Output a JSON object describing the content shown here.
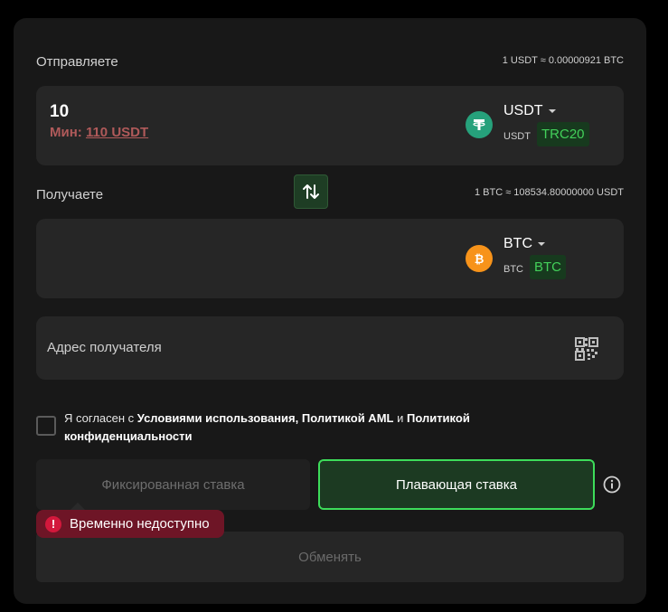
{
  "send": {
    "label": "Отправляете",
    "rate": "1 USDT ≈ 0.00000921 BTC",
    "amount": "10",
    "min_prefix": "Мин:",
    "min_value": "110 USDT",
    "currency": "USDT",
    "currency_small": "USDT",
    "network": "TRC20",
    "coin_icon": "tether-icon",
    "coin_color": "#26a17b"
  },
  "receive": {
    "label": "Получаете",
    "rate": "1 BTC ≈ 108534.80000000 USDT",
    "amount": "",
    "currency": "BTC",
    "currency_small": "BTC",
    "network": "BTC",
    "coin_icon": "bitcoin-icon",
    "coin_color": "#f7931a"
  },
  "address": {
    "placeholder": "Адрес получателя"
  },
  "terms": {
    "prefix": "Я согласен с",
    "terms_link": "Условиями использования,",
    "aml_link": "Политикой AML",
    "and": "и",
    "privacy_link": "Политикой конфиденциальности"
  },
  "rate_type": {
    "fixed": "Фиксированная ставка",
    "floating": "Плавающая ставка"
  },
  "tooltip": {
    "text": "Временно недоступно"
  },
  "submit": {
    "label": "Обменять"
  },
  "colors": {
    "accent": "#3ddc5a",
    "error": "#d3183c",
    "panel": "#262626"
  }
}
